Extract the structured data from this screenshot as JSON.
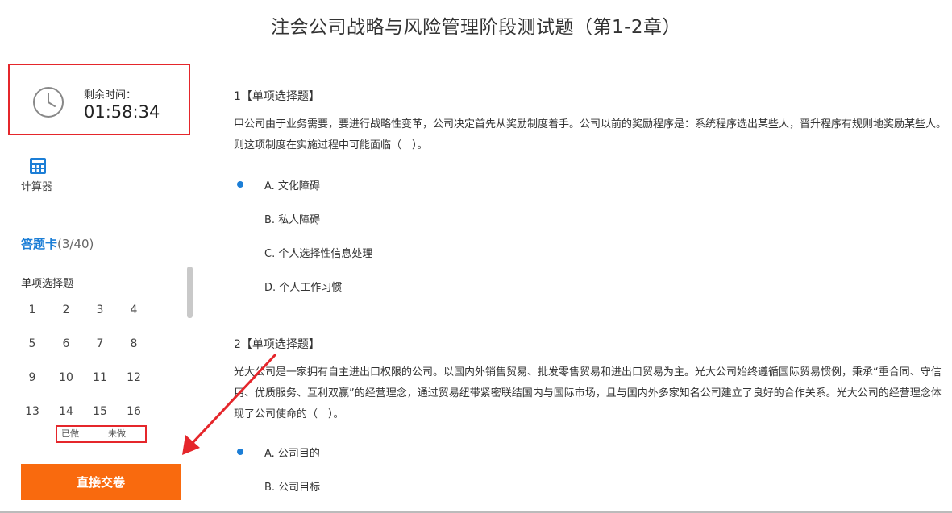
{
  "title": "注会公司战略与风险管理阶段测试题（第1-2章）",
  "timer": {
    "label": "剩余时间：",
    "value": "01:58:34"
  },
  "calculator": {
    "label": "计算器"
  },
  "answer_card": {
    "title": "答题卡",
    "count": "(3/40)",
    "section": "单项选择题",
    "numbers": [
      "1",
      "2",
      "3",
      "4",
      "5",
      "6",
      "7",
      "8",
      "9",
      "10",
      "11",
      "12",
      "13",
      "14",
      "15",
      "16"
    ]
  },
  "legend": {
    "done": "已做",
    "undone": "未做"
  },
  "submit_label": "直接交卷",
  "questions": [
    {
      "head": "1【单项选择题】",
      "text": "甲公司由于业务需要，要进行战略性变革，公司决定首先从奖励制度着手。公司以前的奖励程序是：系统程序选出某些人，晋升程序有规则地奖励某些人。则这项制度在实施过程中可能面临（　）。",
      "options": [
        "A.  文化障碍",
        "B.  私人障碍",
        "C.  个人选择性信息处理",
        "D.  个人工作习惯"
      ]
    },
    {
      "head": "2【单项选择题】",
      "text": "光大公司是一家拥有自主进出口权限的公司。以国内外销售贸易、批发零售贸易和进出口贸易为主。光大公司始终遵循国际贸易惯例，秉承“重合同、守信用、优质服务、互利双赢”的经营理念，通过贸易纽带紧密联结国内与国际市场，且与国内外多家知名公司建立了良好的合作关系。光大公司的经营理念体现了公司使命的（　）。",
      "options": [
        "A.  公司目的",
        "B.  公司目标"
      ]
    }
  ],
  "colors": {
    "accent": "#1c7ed6",
    "submit": "#f96a0e",
    "annotation": "#e5262b"
  }
}
